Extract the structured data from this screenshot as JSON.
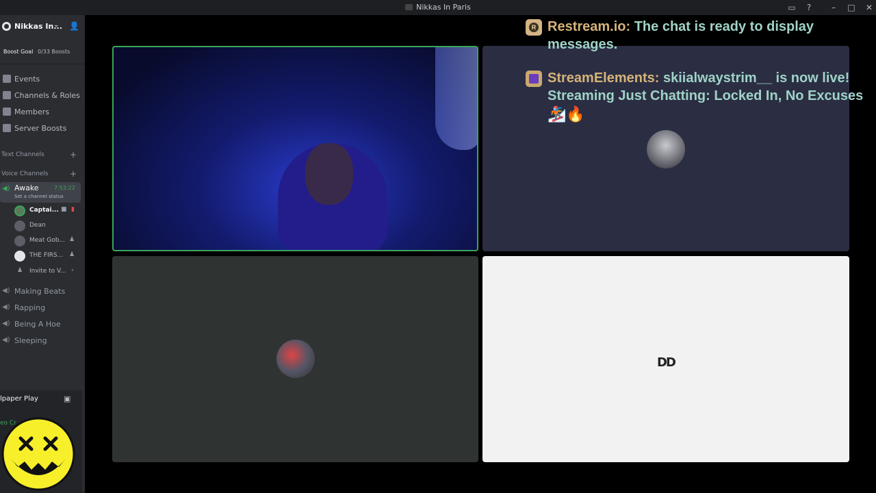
{
  "window": {
    "title": "Nikkas In Paris"
  },
  "sidebar": {
    "server_name": "Nikkas In...",
    "boost_goal_label": "Boost Goal",
    "boost_count": "0/33 Boosts",
    "nav": [
      {
        "label": "Events"
      },
      {
        "label": "Channels & Roles"
      },
      {
        "label": "Members"
      },
      {
        "label": "Server Boosts"
      }
    ],
    "categories": [
      {
        "label": "Text Channels"
      },
      {
        "label": "Voice Channels"
      }
    ],
    "active_channel": {
      "name": "Awake",
      "timer": "7:53:22",
      "status": "Set a channel status"
    },
    "members": [
      {
        "name": "Captai..."
      },
      {
        "name": "Dean"
      },
      {
        "name": "Meat Gob..."
      },
      {
        "name": "THE FIRS..."
      },
      {
        "name": "Invite to V..."
      }
    ],
    "voice_channels": [
      {
        "name": "Making Beats"
      },
      {
        "name": "Rapping"
      },
      {
        "name": "Being A Hoe"
      },
      {
        "name": "Sleeping"
      }
    ],
    "panel": {
      "activity": "lpaper Play",
      "voice_status": "eo Cr"
    }
  },
  "stage": {
    "tile4_avatar_text": "DD"
  },
  "chat": [
    {
      "user": "Restream.io:",
      "body": " The chat is ready to display messages."
    },
    {
      "user": "StreamElements:",
      "body": " skiialwaystrim__ is now live! Streaming Just Chatting: Locked In, No Excuses"
    }
  ],
  "chat_emojis": "🏂🔥"
}
